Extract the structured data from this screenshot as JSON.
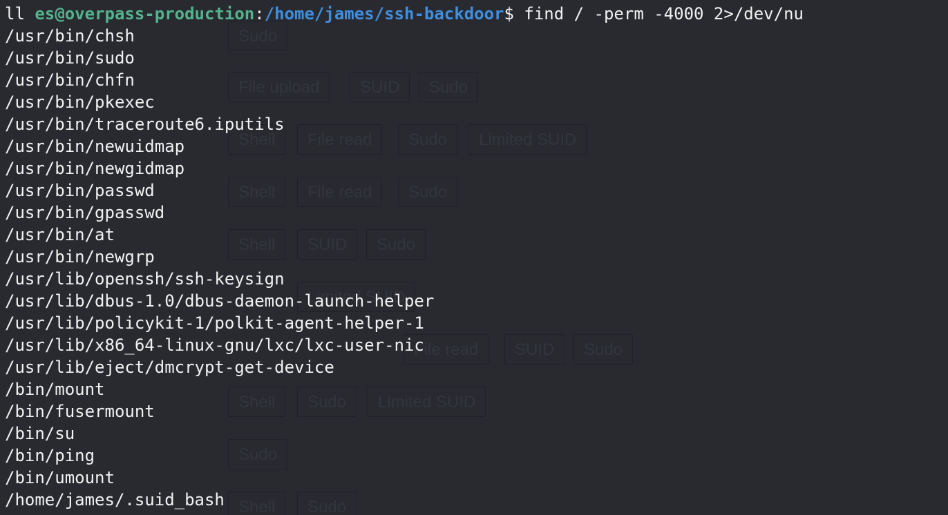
{
  "prompt": {
    "prefix": "ll ",
    "user_host": "es@overpass-production",
    "colon": ":",
    "path": "/home/james/ssh-backdoor",
    "symbol": "$ ",
    "command": "find / -perm -4000 2>/dev/nu"
  },
  "output_lines": [
    "/usr/bin/chsh",
    "/usr/bin/sudo",
    "/usr/bin/chfn",
    "/usr/bin/pkexec",
    "/usr/bin/traceroute6.iputils",
    "/usr/bin/newuidmap",
    "/usr/bin/newgidmap",
    "/usr/bin/passwd",
    "/usr/bin/gpasswd",
    "/usr/bin/at",
    "/usr/bin/newgrp",
    "/usr/lib/openssh/ssh-keysign",
    "/usr/lib/dbus-1.0/dbus-daemon-launch-helper",
    "/usr/lib/policykit-1/polkit-agent-helper-1",
    "/usr/lib/x86_64-linux-gnu/lxc/lxc-user-nic",
    "/usr/lib/eject/dmcrypt-get-device",
    "/bin/mount",
    "/bin/fusermount",
    "/bin/su",
    "/bin/ping",
    "/bin/umount",
    "/home/james/.suid_bash"
  ],
  "ghost_tags": {
    "row1": [
      "Sudo"
    ],
    "row2": [
      "File upload",
      "SUID",
      "Sudo"
    ],
    "row3": [
      "Shell",
      "File read",
      "Sudo",
      "Limited SUID"
    ],
    "row4": [
      "Shell",
      "File read",
      "Sudo"
    ],
    "row5": [
      "Shell",
      "SUID",
      "Sudo"
    ],
    "row6": [
      "Limited SUID"
    ],
    "row7": [
      "File read",
      "SUID",
      "Sudo"
    ],
    "row8": [
      "Shell",
      "Sudo",
      "Limited SUID"
    ],
    "row9": [
      "Sudo"
    ],
    "row10": [
      "Shell",
      "Sudo"
    ]
  },
  "colors": {
    "background": "#282a30",
    "text": "#f2f2f2",
    "user_host": "#54b38c",
    "path": "#3f8fe0"
  }
}
